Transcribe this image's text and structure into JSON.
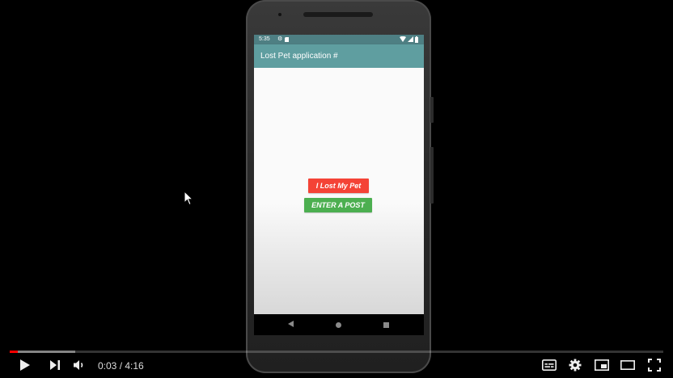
{
  "player": {
    "progress_played_fraction": 0.012,
    "progress_loaded_fraction": 0.1,
    "time_current": "0:03",
    "time_separator": " / ",
    "time_total": "4:16",
    "colors": {
      "played": "#ff0000",
      "icon": "#eeeeee"
    },
    "controls": {
      "left": [
        "play-icon",
        "next-icon",
        "volume-icon"
      ],
      "right": [
        "subtitles-icon",
        "settings-icon",
        "miniplayer-icon",
        "theater-icon",
        "fullscreen-icon"
      ]
    }
  },
  "phone": {
    "status_time": "5:35",
    "app_title": "Lost Pet application #",
    "buttons": {
      "lost": "I Lost My Pet",
      "post": "ENTER A POST"
    },
    "colors": {
      "appbar": "#5f9ea0",
      "statusbar": "#4e7f83",
      "lost_button": "#f44336",
      "post_button": "#4caf50"
    }
  }
}
